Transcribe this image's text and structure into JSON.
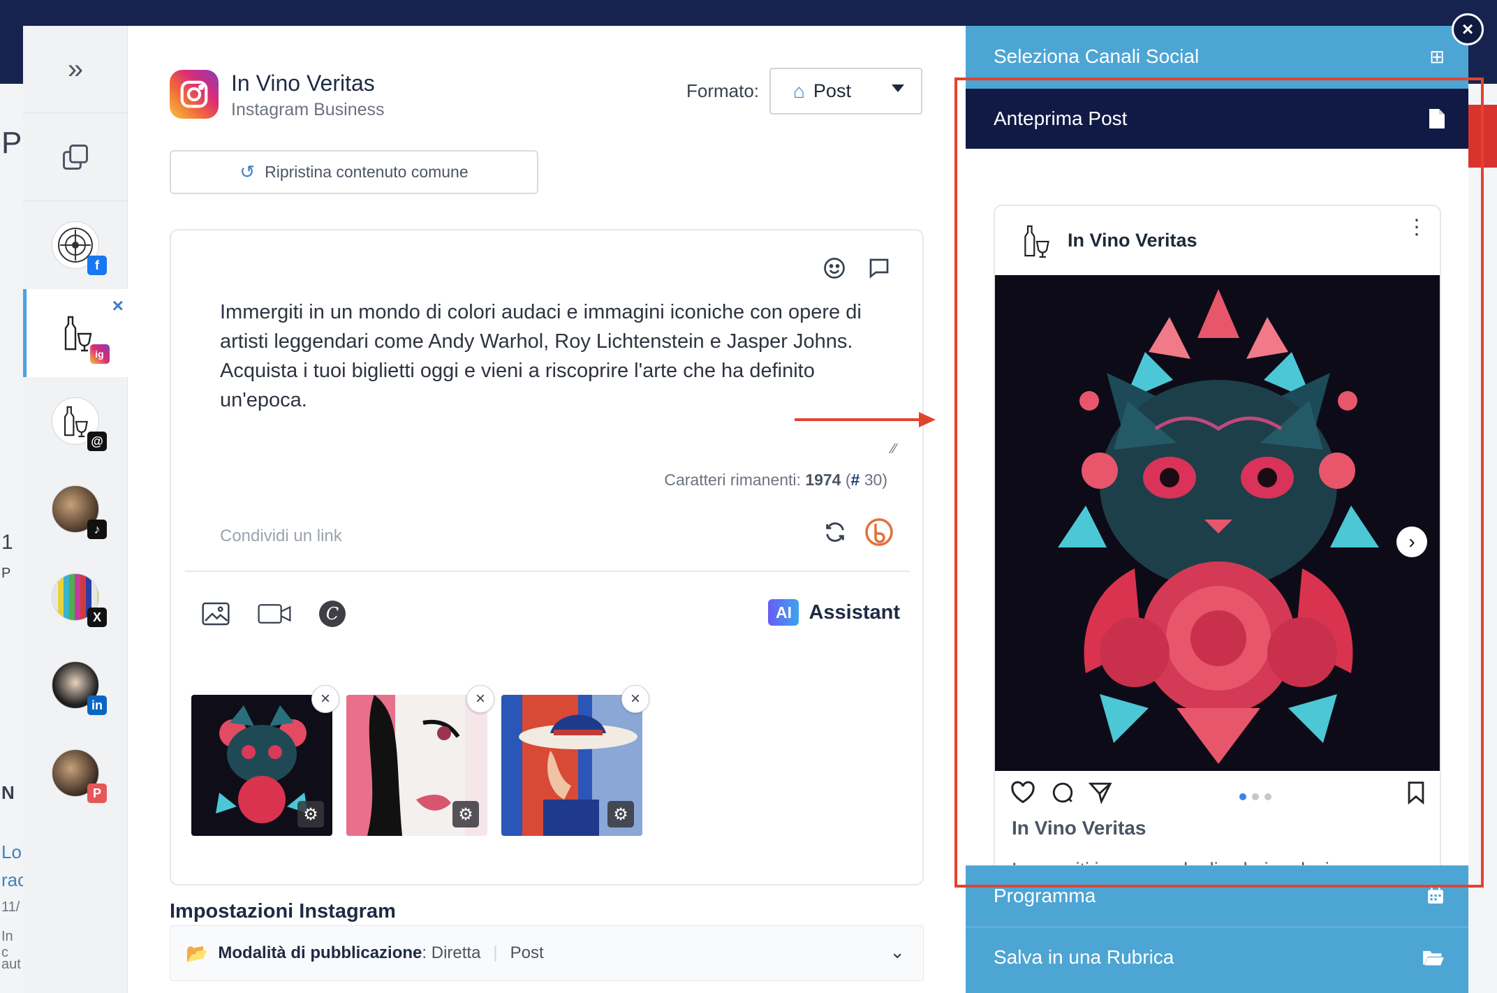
{
  "background": {
    "left_fragments": [
      "P",
      "1",
      "P",
      "N",
      "Lo",
      "rac",
      "11/",
      "In c",
      "aut"
    ]
  },
  "sidebar": {
    "expand_label": "»",
    "channels": [
      {
        "network": "facebook",
        "badge": "f",
        "active": false
      },
      {
        "network": "instagram",
        "badge": "ig",
        "active": true
      },
      {
        "network": "threads",
        "badge": "@",
        "active": false
      },
      {
        "network": "tiktok",
        "badge": "♪",
        "active": false
      },
      {
        "network": "x",
        "badge": "X",
        "active": false
      },
      {
        "network": "linkedin",
        "badge": "in",
        "active": false
      },
      {
        "network": "pinterest",
        "badge": "P",
        "active": false
      }
    ]
  },
  "account": {
    "name": "In Vino Veritas",
    "type": "Instagram Business"
  },
  "format": {
    "label": "Formato:",
    "value": "Post"
  },
  "restore_button": "Ripristina contenuto comune",
  "post": {
    "text": "Immergiti in un mondo di colori audaci e immagini iconiche con opere di artisti leggendari come Andy Warhol, Roy Lichtenstein e Jasper Johns. Acquista i tuoi biglietti oggi e vieni a riscoprire l'arte che ha definito un'epoca.",
    "chars_label": "Caratteri rimanenti:",
    "chars_remaining": "1974",
    "hashtags_remaining": "30",
    "link_placeholder": "Condividi un link"
  },
  "ai": {
    "badge": "AI",
    "label": "Assistant"
  },
  "settings": {
    "title": "Impostazioni Instagram",
    "mode_label": "Modalità di pubblicazione",
    "mode_value": "Diretta",
    "mode_format": "Post"
  },
  "panel": {
    "select_channels": "Seleziona Canali Social",
    "preview": "Anteprima Post",
    "program": "Programma",
    "save": "Salva in una Rubrica"
  },
  "preview": {
    "account": "In Vino Veritas",
    "username": "In Vino Veritas",
    "caption": "Immergiti in un mondo di colori audaci e",
    "carousel_count": 3,
    "carousel_index": 1
  },
  "colors": {
    "panel": "#4da5d4",
    "panel_active": "#101a45",
    "highlight": "#e2432f",
    "accent": "#3b82c4"
  }
}
